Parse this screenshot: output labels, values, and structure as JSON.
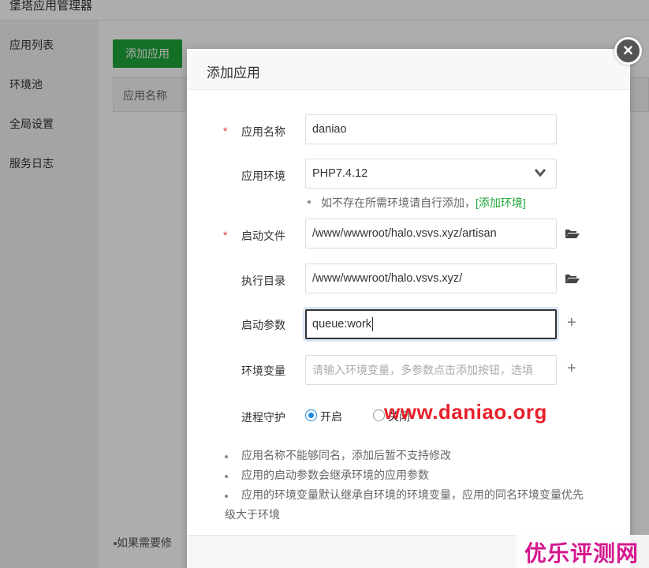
{
  "app": {
    "title": "堡塔应用管理器"
  },
  "sidebar": {
    "items": [
      {
        "label": "应用列表"
      },
      {
        "label": "环境池"
      },
      {
        "label": "全局设置"
      },
      {
        "label": "服务日志"
      }
    ]
  },
  "main": {
    "add_button": "添加应用",
    "table_header": "应用名称",
    "note_partial": "如果需要修"
  },
  "modal": {
    "title": "添加应用",
    "close_symbol": "×",
    "fields": {
      "app_name": {
        "label": "应用名称",
        "value": "daniao",
        "required": true
      },
      "app_env": {
        "label": "应用环境",
        "value": "PHP7.4.12"
      },
      "env_hint": {
        "text": "如不存在所需环境请自行添加，",
        "link": "[添加环境]"
      },
      "start_file": {
        "label": "启动文件",
        "value": "/www/wwwroot/halo.vsvs.xyz/artisan",
        "required": true
      },
      "exec_dir": {
        "label": "执行目录",
        "value": "/www/wwwroot/halo.vsvs.xyz/"
      },
      "start_params": {
        "label": "启动参数",
        "value": "queue:work"
      },
      "env_vars": {
        "label": "环境变量",
        "placeholder": "请输入环境变量，多参数点击添加按钮，选填"
      },
      "daemon": {
        "label": "进程守护",
        "on_label": "开启",
        "off_label": "关闭",
        "selected": "on"
      }
    },
    "notes": [
      "应用名称不能够同名，添加后暂不支持修改",
      "应用的启动参数会继承环境的应用参数",
      "应用的环境变量默认继承自环境的环境变量，应用的同名环境变量优先",
      "级大于环境"
    ]
  },
  "watermarks": {
    "site": "www.daniao.org",
    "brand": "优乐评测网"
  },
  "colors": {
    "accent_green": "#20a53a",
    "required_red": "#e33333",
    "radio_blue": "#1e88e5",
    "watermark_red": "#e8202a",
    "watermark_magenta": "#d4198f"
  },
  "icons": {
    "select": "chevron-down-icon",
    "folder": "folder-open-icon",
    "add": "plus-icon",
    "close": "close-icon"
  }
}
